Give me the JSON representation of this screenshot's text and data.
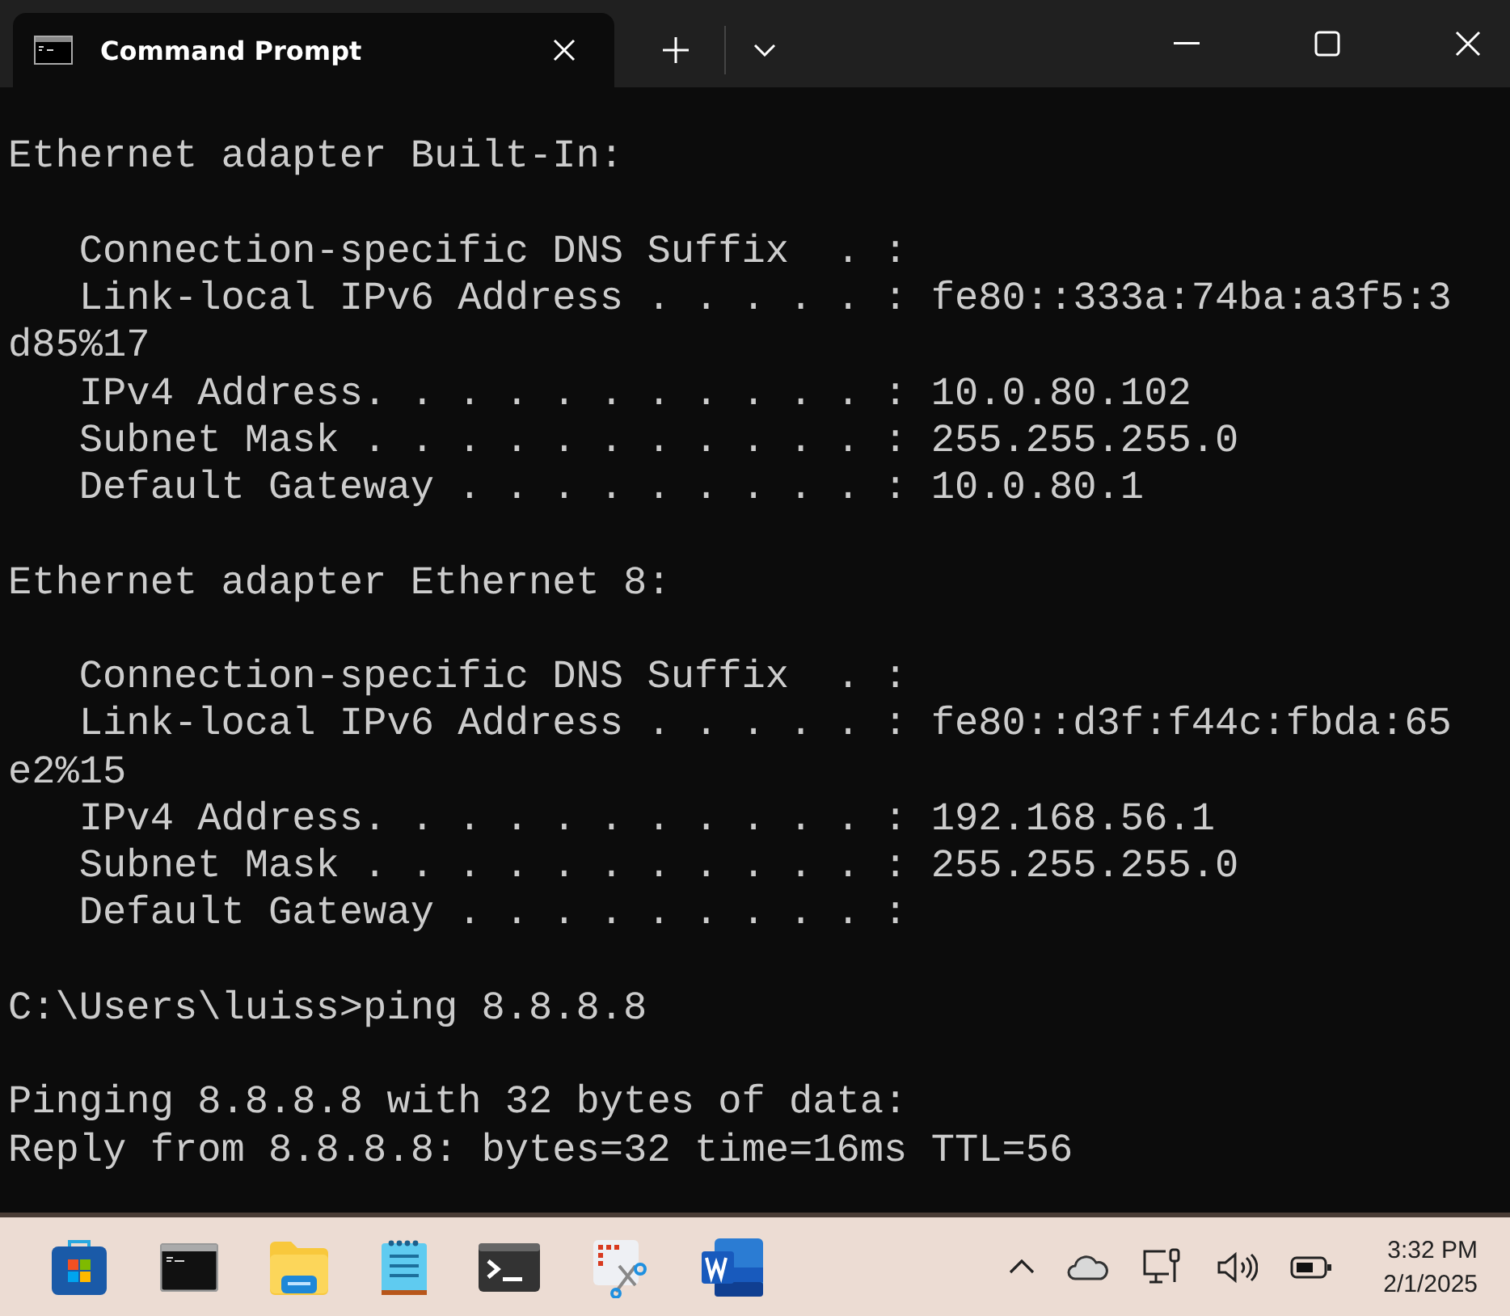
{
  "window": {
    "tab_title": "Command Prompt"
  },
  "terminal": {
    "blocks": [
      [
        "Ethernet adapter Built-In:"
      ],
      [
        "   Connection-specific DNS Suffix  . :",
        "   Link-local IPv6 Address . . . . . : fe80::333a:74ba:a3f5:3",
        "d85%17",
        "   IPv4 Address. . . . . . . . . . . : 10.0.80.102",
        "   Subnet Mask . . . . . . . . . . . : 255.255.255.0",
        "   Default Gateway . . . . . . . . . : 10.0.80.1"
      ],
      [
        "Ethernet adapter Ethernet 8:"
      ],
      [
        "   Connection-specific DNS Suffix  . :",
        "   Link-local IPv6 Address . . . . . : fe80::d3f:f44c:fbda:65",
        "e2%15",
        "   IPv4 Address. . . . . . . . . . . : 192.168.56.1",
        "   Subnet Mask . . . . . . . . . . . : 255.255.255.0",
        "   Default Gateway . . . . . . . . . :"
      ],
      [
        "C:\\Users\\luiss>ping 8.8.8.8"
      ],
      [
        "Pinging 8.8.8.8 with 32 bytes of data:",
        "Reply from 8.8.8.8: bytes=32 time=16ms TTL=56"
      ]
    ]
  },
  "taskbar": {
    "time": "3:32 PM",
    "date": "2/1/2025"
  }
}
